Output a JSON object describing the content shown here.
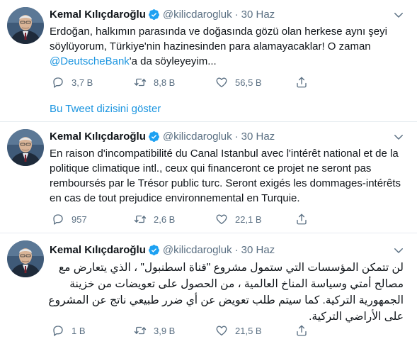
{
  "tweets": [
    {
      "author_name": "Kemal Kılıçdaroğlu",
      "handle": "@kilicdarogluk",
      "separator": "·",
      "time": "30 Haz",
      "text_before": "Erdoğan, halkımın parasında ve doğasında gözü olan herkese aynı şeyi söylüyorum, Türkiye'nin hazinesinden para alamayacaklar! O zaman ",
      "mention": "@DeutscheBank",
      "text_after": "'a da söyleyeyim...",
      "replies": "3,7 B",
      "retweets": "8,8 B",
      "likes": "56,5 B"
    },
    {
      "author_name": "Kemal Kılıçdaroğlu",
      "handle": "@kilicdarogluk",
      "separator": "·",
      "time": "30 Haz",
      "text": "En raison d'incompatibilité du Canal Istanbul avec l'intérêt national et de la politique climatique intl., ceux qui financeront ce projet ne seront pas remboursés par le Trésor public turc. Seront exigés les dommages-intérêts en cas de tout prejudice environnemental en Turquie.",
      "replies": "957",
      "retweets": "2,6 B",
      "likes": "22,1 B"
    },
    {
      "author_name": "Kemal Kılıçdaroğlu",
      "handle": "@kilicdarogluk",
      "separator": "·",
      "time": "30 Haz",
      "text": "لن تتمكن المؤسسات التي ستمول مشروع \"قناة اسطنبول\" ، الذي يتعارض مع مصالح أمتي وسياسة المناخ العالمية ، من الحصول على تعويضات من خزينة الجمهورية التركية.  كما سيتم طلب تعويض عن أي ضرر طبيعي ناتج عن المشروع على الأراضي التركية.",
      "replies": "1 B",
      "retweets": "3,9 B",
      "likes": "21,5 B"
    }
  ],
  "thread_link": "Bu Tweet dizisini göster",
  "colors": {
    "accent": "#1b95e0",
    "verified": "#1da1f2",
    "muted": "#5b7083",
    "divider": "#e6ecf0",
    "text": "#0f1419"
  },
  "icons": [
    "verified-badge-icon",
    "more-caret-icon",
    "reply-icon",
    "retweet-icon",
    "like-icon",
    "share-icon"
  ]
}
